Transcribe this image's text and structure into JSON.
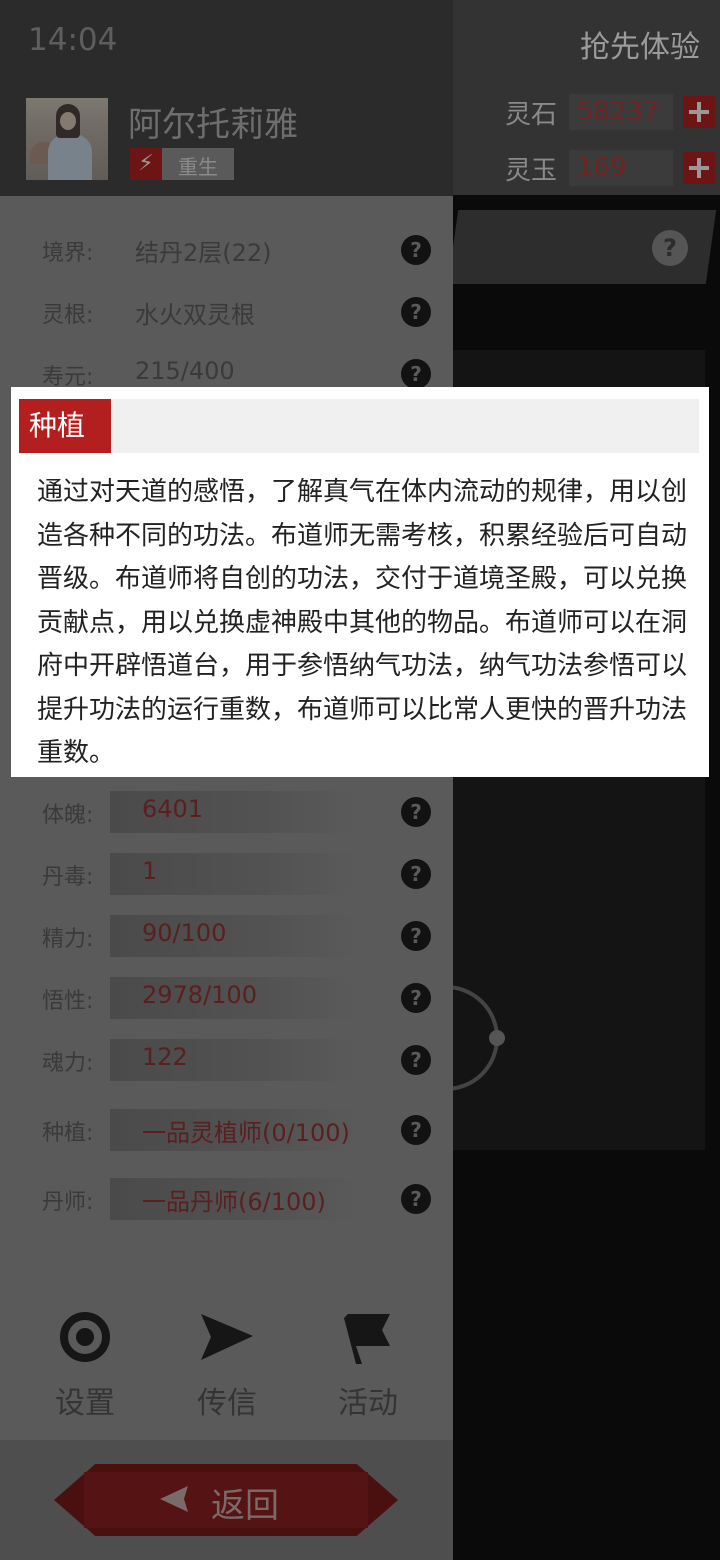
{
  "status_bar": {
    "time": "14:04"
  },
  "top_right": {
    "first_experience": "抢先体验"
  },
  "currencies": [
    {
      "label": "灵石",
      "value": "58237"
    },
    {
      "label": "灵玉",
      "value": "169"
    }
  ],
  "character": {
    "name": "阿尔托莉雅",
    "rebirth_label": "重生"
  },
  "stats_upper": [
    {
      "label": "境界:",
      "value": "结丹2层(22)"
    },
    {
      "label": "灵根:",
      "value": "水火双灵根"
    },
    {
      "label": "寿元:",
      "value": "215/400"
    }
  ],
  "stats_lower": [
    {
      "label": "体魄:",
      "value": "6401"
    },
    {
      "label": "丹毒:",
      "value": "1"
    },
    {
      "label": "精力:",
      "value": "90/100"
    },
    {
      "label": "悟性:",
      "value": "2978/100"
    },
    {
      "label": "魂力:",
      "value": "122"
    },
    {
      "label": "种植:",
      "value": "一品灵植师(0/100)"
    },
    {
      "label": "丹师:",
      "value": "一品丹师(6/100)"
    }
  ],
  "bottom_buttons": {
    "settings": "设置",
    "message": "传信",
    "activity": "活动"
  },
  "back_button": "返回",
  "popup": {
    "title": "种植",
    "text": "通过对天道的感悟，了解真气在体内流动的规律，用以创造各种不同的功法。布道师无需考核，积累经验后可自动晋级。布道师将自创的功法，交付于道境圣殿，可以兑换贡献点，用以兑换虚神殿中其他的物品。布道师可以在洞府中开辟悟道台，用于参悟纳气功法，纳气功法参悟可以提升功法的运行重数，布道师可以比常人更快的晋升功法重数。"
  },
  "colors": {
    "accent_red": "#b31e1e",
    "panel_gray": "#5a5a5a",
    "overlay_dark": "#2b2b2b"
  }
}
